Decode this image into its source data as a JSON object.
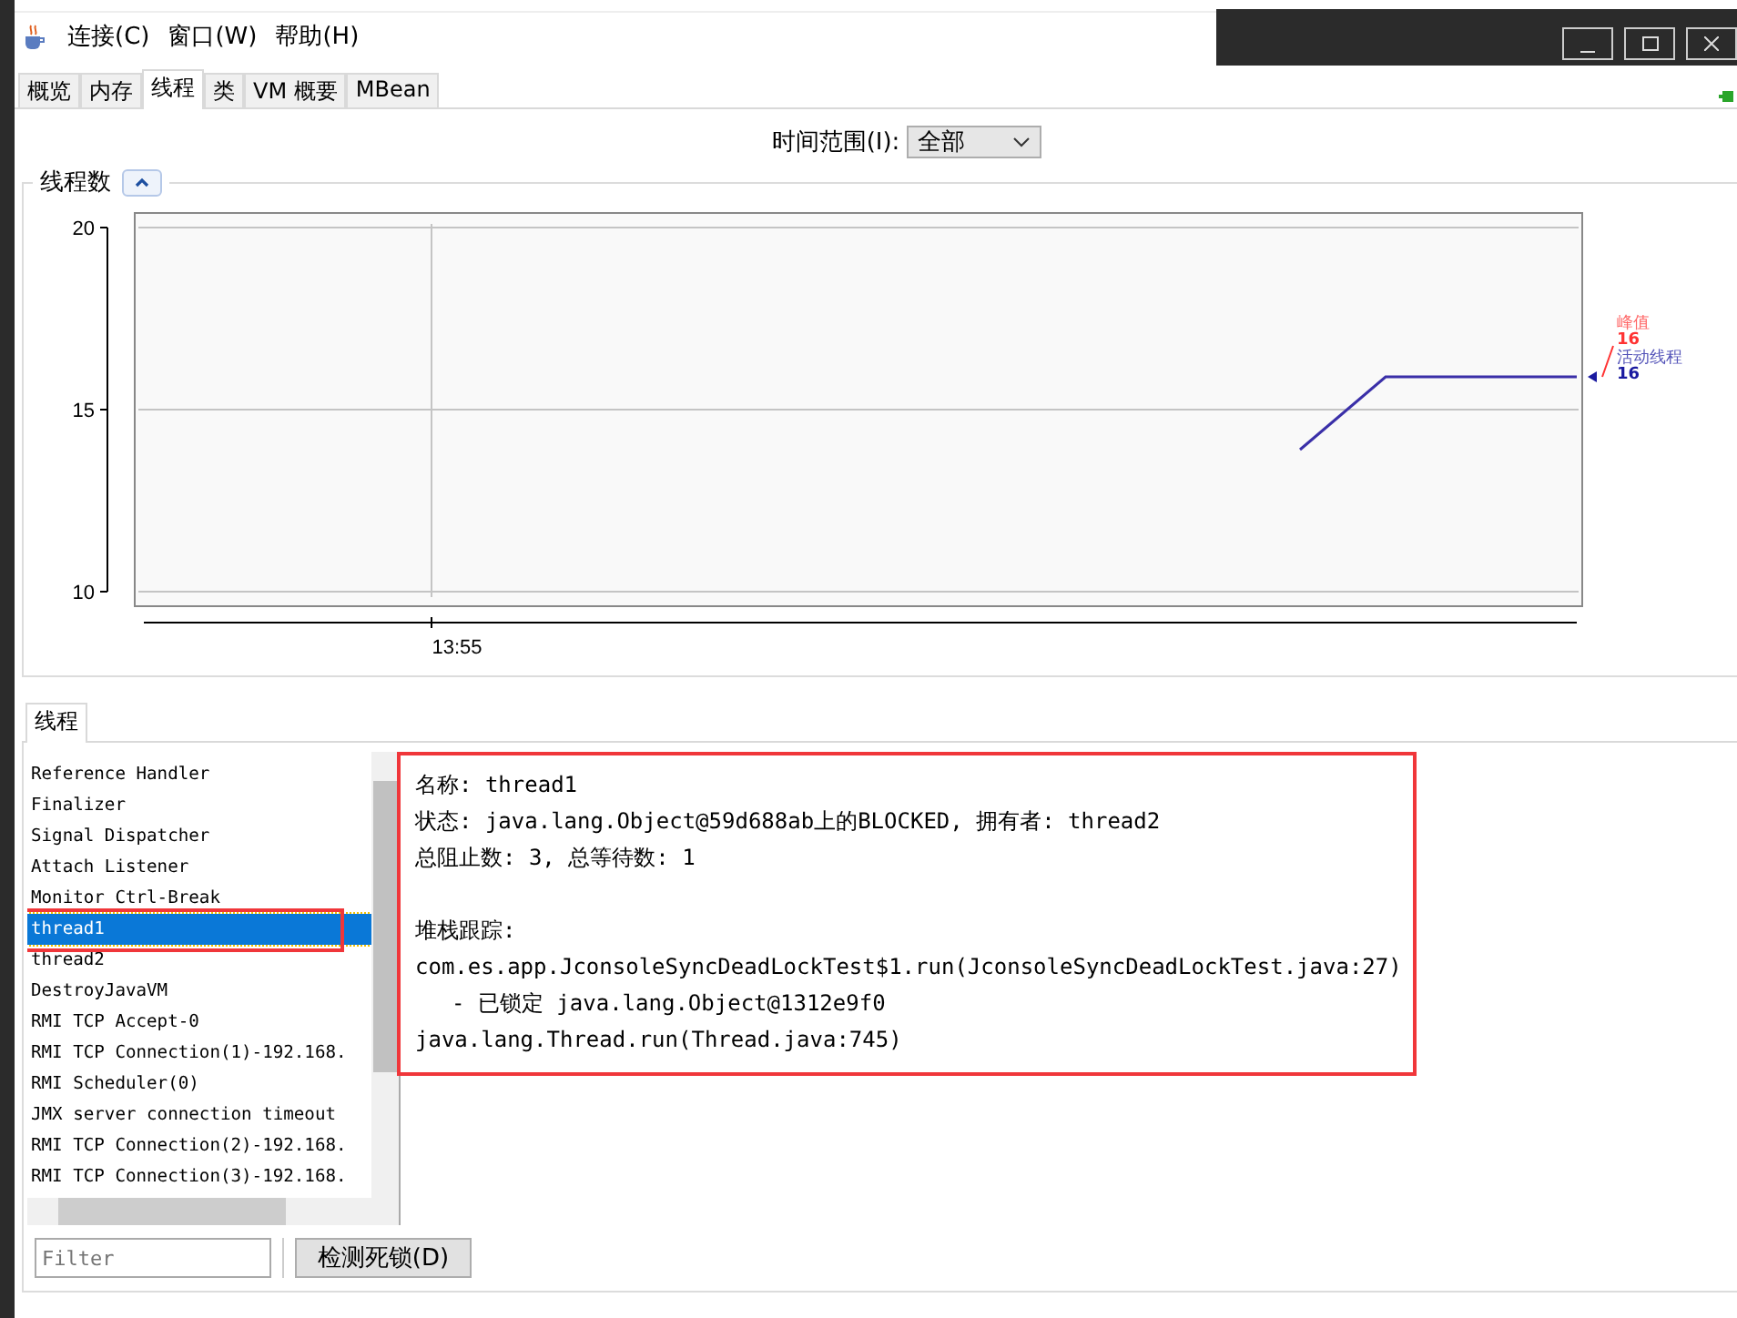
{
  "menu": [
    "连接(C)",
    "窗口(W)",
    "帮助(H)"
  ],
  "tabs": [
    {
      "label": "概览",
      "selected": false
    },
    {
      "label": "内存",
      "selected": false
    },
    {
      "label": "线程",
      "selected": true
    },
    {
      "label": "类",
      "selected": false
    },
    {
      "label": "VM 概要",
      "selected": false
    },
    {
      "label": "MBean",
      "selected": false
    }
  ],
  "time_range": {
    "label": "时间范围(I):",
    "value": "全部"
  },
  "chart_panel": {
    "title": "线程数",
    "y_ticks": [
      "20",
      "15",
      "10"
    ],
    "x_tick": "13:55",
    "legend": [
      {
        "label": "峰值",
        "value": "16",
        "color": "#ff3333"
      },
      {
        "label": "活动线程",
        "value": "16",
        "color": "#1a1aa0"
      }
    ]
  },
  "threads_panel": {
    "tab": "线程",
    "threads": [
      {
        "name": "Reference Handler",
        "selected": false
      },
      {
        "name": "Finalizer",
        "selected": false
      },
      {
        "name": "Signal Dispatcher",
        "selected": false
      },
      {
        "name": "Attach Listener",
        "selected": false
      },
      {
        "name": "Monitor Ctrl-Break",
        "selected": false
      },
      {
        "name": "thread1",
        "selected": true
      },
      {
        "name": "thread2",
        "selected": false
      },
      {
        "name": "DestroyJavaVM",
        "selected": false
      },
      {
        "name": "RMI TCP Accept-0",
        "selected": false
      },
      {
        "name": "RMI TCP Connection(1)-192.168.",
        "selected": false
      },
      {
        "name": "RMI Scheduler(0)",
        "selected": false
      },
      {
        "name": "JMX server connection timeout",
        "selected": false
      },
      {
        "name": "RMI TCP Connection(2)-192.168.",
        "selected": false
      },
      {
        "name": "RMI TCP Connection(3)-192.168.",
        "selected": false
      }
    ],
    "details": [
      "名称: thread1",
      "状态: java.lang.Object@59d688ab上的BLOCKED, 拥有者: thread2",
      "总阻止数: 3, 总等待数: 1"
    ],
    "stack_title": "堆栈跟踪:",
    "stack": [
      {
        "kind": "frame",
        "text": "com.es.app.JconsoleSyncDeadLockTest$1.run(JconsoleSyncDeadLockTest.java:27)"
      },
      {
        "kind": "lock",
        "text": "- 已锁定 java.lang.Object@1312e9f0"
      },
      {
        "kind": "frame",
        "text": "java.lang.Thread.run(Thread.java:745)"
      }
    ],
    "filter": {
      "placeholder": "Filter"
    },
    "detect_button": "检测死锁(D)"
  }
}
